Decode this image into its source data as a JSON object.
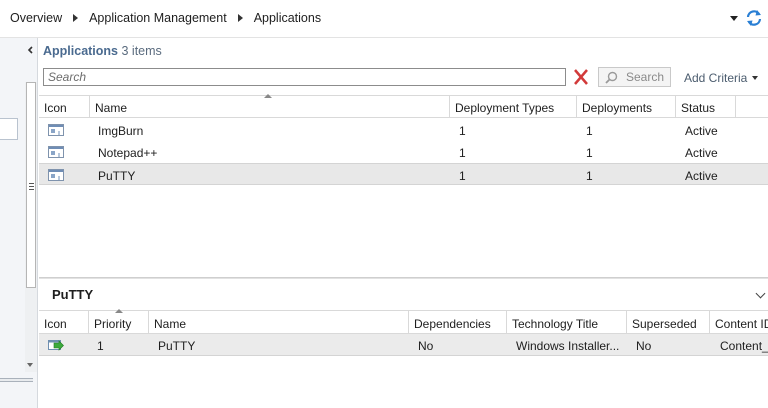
{
  "breadcrumb": [
    "Overview",
    "Application Management",
    "Applications"
  ],
  "list": {
    "title": "Applications",
    "count": "3 items",
    "search_placeholder": "Search",
    "search_button": "Search",
    "add_criteria": "Add Criteria"
  },
  "columns": {
    "icon": "Icon",
    "name": "Name",
    "deployment_types": "Deployment Types",
    "deployments": "Deployments",
    "status": "Status"
  },
  "rows": [
    {
      "name": "ImgBurn",
      "deployment_types": "1",
      "deployments": "1",
      "status": "Active"
    },
    {
      "name": "Notepad++",
      "deployment_types": "1",
      "deployments": "1",
      "status": "Active"
    },
    {
      "name": "PuTTY",
      "deployment_types": "1",
      "deployments": "1",
      "status": "Active"
    }
  ],
  "selected_row": "PuTTY",
  "details": {
    "title": "PuTTY",
    "columns": {
      "icon": "Icon",
      "priority": "Priority",
      "name": "Name",
      "dependencies": "Dependencies",
      "technology_title": "Technology Title",
      "superseded": "Superseded",
      "content_id": "Content ID"
    },
    "rows": [
      {
        "priority": "1",
        "name": "PuTTY",
        "dependencies": "No",
        "technology_title": "Windows Installer...",
        "superseded": "No",
        "content_id": "Content_"
      }
    ]
  },
  "colors": {
    "title_blue": "#4a6a8f",
    "selected_row": "#e8e8e8",
    "refresh_icon": "#2a7fd4",
    "clear_icon": "#d23a3a"
  }
}
